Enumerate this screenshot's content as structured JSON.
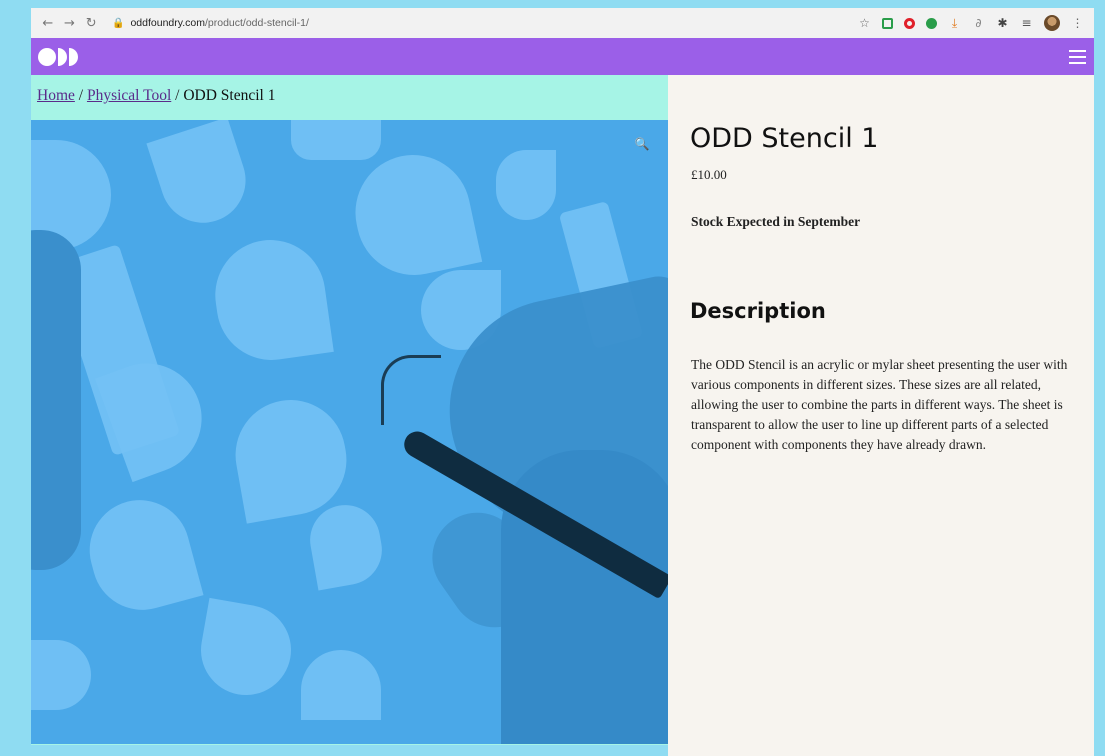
{
  "browser": {
    "url_domain": "oddfoundry.com",
    "url_path": "/product/odd-stencil-1/"
  },
  "icons": {
    "back": "back-arrow-icon",
    "forward": "forward-arrow-icon",
    "reload": "reload-icon",
    "lock": "lock-icon",
    "star": "star-icon",
    "menu": "hamburger-menu-icon",
    "zoom": "magnifier-icon"
  },
  "breadcrumb": {
    "home": "Home",
    "sep1": "/",
    "category": "Physical Tool",
    "sep2": "/",
    "current": "ODD Stencil 1"
  },
  "product": {
    "title": "ODD Stencil 1",
    "price": "£10.00",
    "stock": "Stock Expected in September",
    "description_heading": "Description",
    "description": "The ODD Stencil is an acrylic or mylar sheet presenting the user with various components in different sizes. These sizes are all related, allowing the user to combine the parts in different ways. The sheet is transparent to allow the user to line up different parts of a selected component with components they have already drawn."
  },
  "colors": {
    "header": "#9b5fe8",
    "left_panel": "#a6f4e6",
    "right_panel": "#f7f4ef",
    "image_tint": "#4aa8e8",
    "breadcrumb_link": "#5a2c8a"
  }
}
